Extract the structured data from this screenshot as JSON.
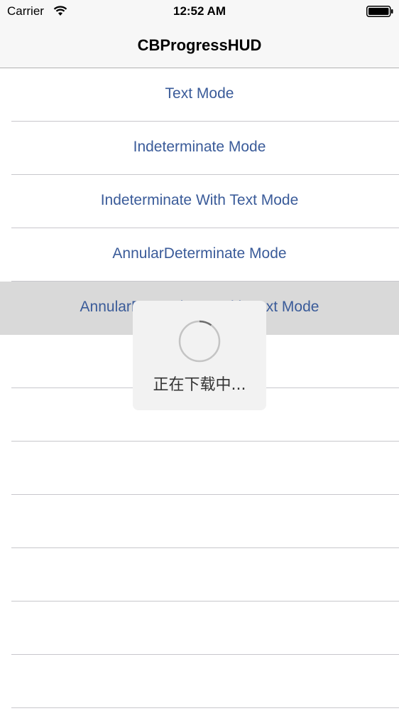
{
  "status_bar": {
    "carrier": "Carrier",
    "time": "12:52 AM",
    "wifi_icon": "wifi-icon",
    "battery_icon": "battery-icon"
  },
  "nav": {
    "title": "CBProgressHUD"
  },
  "table": {
    "rows": [
      {
        "label": "Text Mode"
      },
      {
        "label": "Indeterminate Mode"
      },
      {
        "label": "Indeterminate With Text Mode"
      },
      {
        "label": "AnnularDeterminate Mode"
      },
      {
        "label": "AnnularDeterminate With Text Mode",
        "selected": true
      },
      {
        "label": ""
      },
      {
        "label": ""
      },
      {
        "label": ""
      },
      {
        "label": ""
      },
      {
        "label": ""
      },
      {
        "label": ""
      },
      {
        "label": ""
      }
    ]
  },
  "hud": {
    "message": "正在下载中...",
    "progress": 0.1,
    "icon": "spinner-icon"
  },
  "colors": {
    "accent": "#3a5b99",
    "selected_row": "#d9d9d9",
    "separator": "#c8c7cc",
    "hud_background": "#f2f2f2"
  }
}
